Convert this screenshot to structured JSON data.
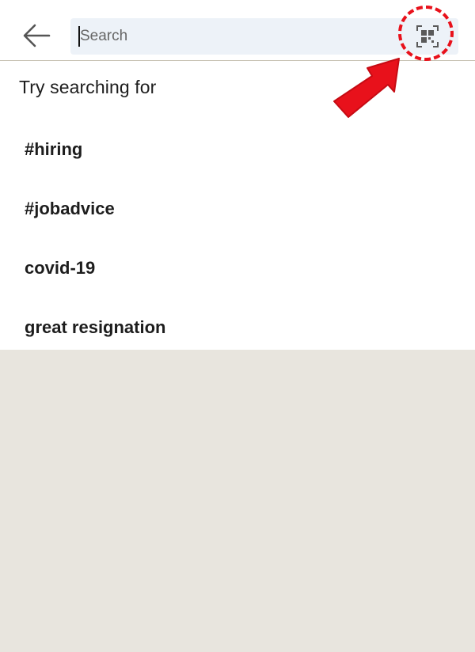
{
  "header": {
    "back_icon": "arrow-left-icon",
    "search": {
      "value": "",
      "placeholder": "Search"
    },
    "qr_icon": "qr-code-scan-icon"
  },
  "suggestions": {
    "title": "Try searching for",
    "items": [
      {
        "label": "#hiring"
      },
      {
        "label": "#jobadvice"
      },
      {
        "label": "covid-19"
      },
      {
        "label": "great resignation"
      }
    ]
  },
  "annotation": {
    "arrow_icon": "pointing-arrow-icon",
    "circle_icon": "dashed-highlight-circle",
    "color": "#e8111b"
  },
  "colors": {
    "search_bg": "#edf2f8",
    "page_bg": "#e8e5de",
    "text": "#1d1d1d"
  }
}
